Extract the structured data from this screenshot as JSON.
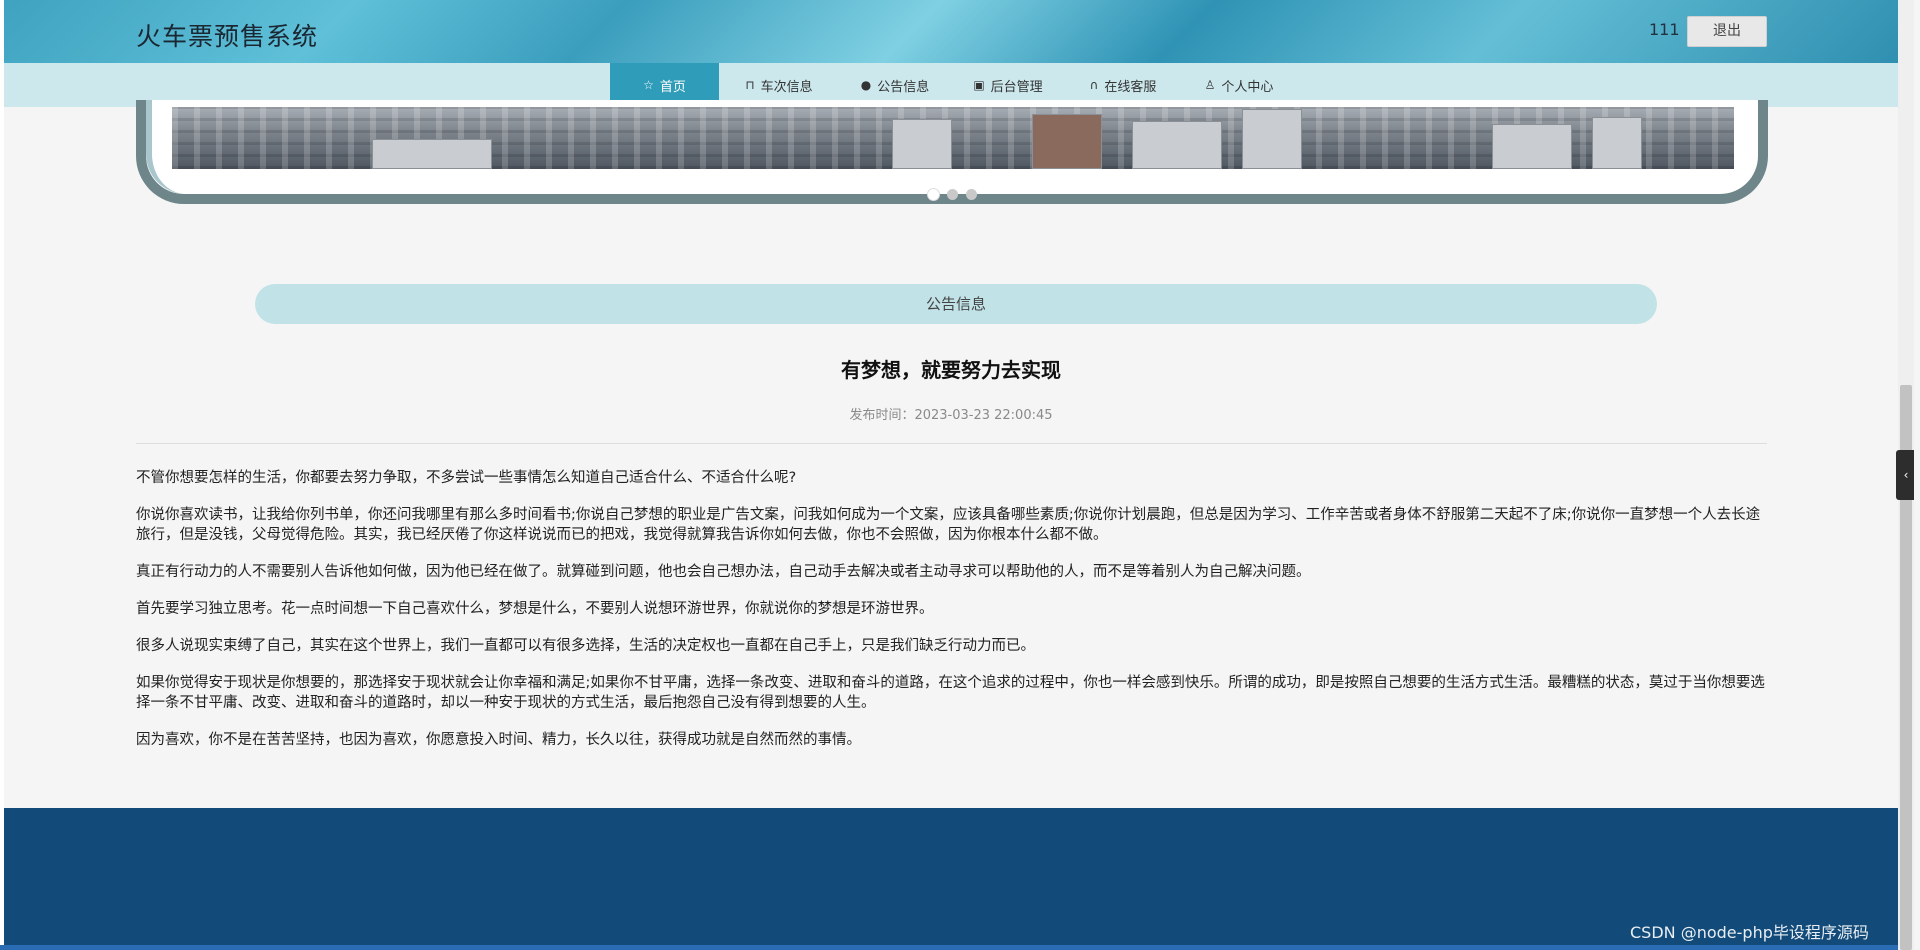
{
  "header": {
    "site_title": "火车票预售系统",
    "user_name": "111",
    "logout_label": "退出"
  },
  "nav": {
    "items": [
      {
        "label": "首页",
        "icon": "star-icon",
        "active": true
      },
      {
        "label": "车次信息",
        "icon": "bag-icon",
        "active": false
      },
      {
        "label": "公告信息",
        "icon": "alert-icon",
        "active": false
      },
      {
        "label": "后台管理",
        "icon": "briefcase-icon",
        "active": false
      },
      {
        "label": "在线客服",
        "icon": "headset-icon",
        "active": false
      },
      {
        "label": "个人中心",
        "icon": "user-icon",
        "active": false
      }
    ]
  },
  "carousel": {
    "dot_count": 3,
    "active_index": 0
  },
  "section": {
    "header": "公告信息"
  },
  "article": {
    "title": "有梦想，就要努力去实现",
    "publish_time": "发布时间：2023-03-23 22:00:45",
    "paragraphs": [
      "不管你想要怎样的生活，你都要去努力争取，不多尝试一些事情怎么知道自己适合什么、不适合什么呢?",
      "你说你喜欢读书，让我给你列书单，你还问我哪里有那么多时间看书;你说自己梦想的职业是广告文案，问我如何成为一个文案，应该具备哪些素质;你说你计划晨跑，但总是因为学习、工作辛苦或者身体不舒服第二天起不了床;你说你一直梦想一个人去长途旅行，但是没钱，父母觉得危险。其实，我已经厌倦了你这样说说而已的把戏，我觉得就算我告诉你如何去做，你也不会照做，因为你根本什么都不做。",
      "真正有行动力的人不需要别人告诉他如何做，因为他已经在做了。就算碰到问题，他也会自己想办法，自己动手去解决或者主动寻求可以帮助他的人，而不是等着别人为自己解决问题。",
      "首先要学习独立思考。花一点时间想一下自己喜欢什么，梦想是什么，不要别人说想环游世界，你就说你的梦想是环游世界。",
      "很多人说现实束缚了自己，其实在这个世界上，我们一直都可以有很多选择，生活的决定权也一直都在自己手上，只是我们缺乏行动力而已。",
      "如果你觉得安于现状是你想要的，那选择安于现状就会让你幸福和满足;如果你不甘平庸，选择一条改变、进取和奋斗的道路，在这个追求的过程中，你也一样会感到快乐。所谓的成功，即是按照自己想要的生活方式生活。最糟糕的状态，莫过于当你想要选择一条不甘平庸、改变、进取和奋斗的道路时，却以一种安于现状的方式生活，最后抱怨自己没有得到想要的人生。",
      "因为喜欢，你不是在苦苦坚持，也因为喜欢，你愿意投入时间、精力，长久以往，获得成功就是自然而然的事情。"
    ]
  },
  "footer": {
    "watermark": "CSDN @node-php毕设程序源码"
  },
  "colors": {
    "nav_active": "#2f9db9",
    "footer": "#124a79",
    "section_header": "#c1e3e7"
  }
}
